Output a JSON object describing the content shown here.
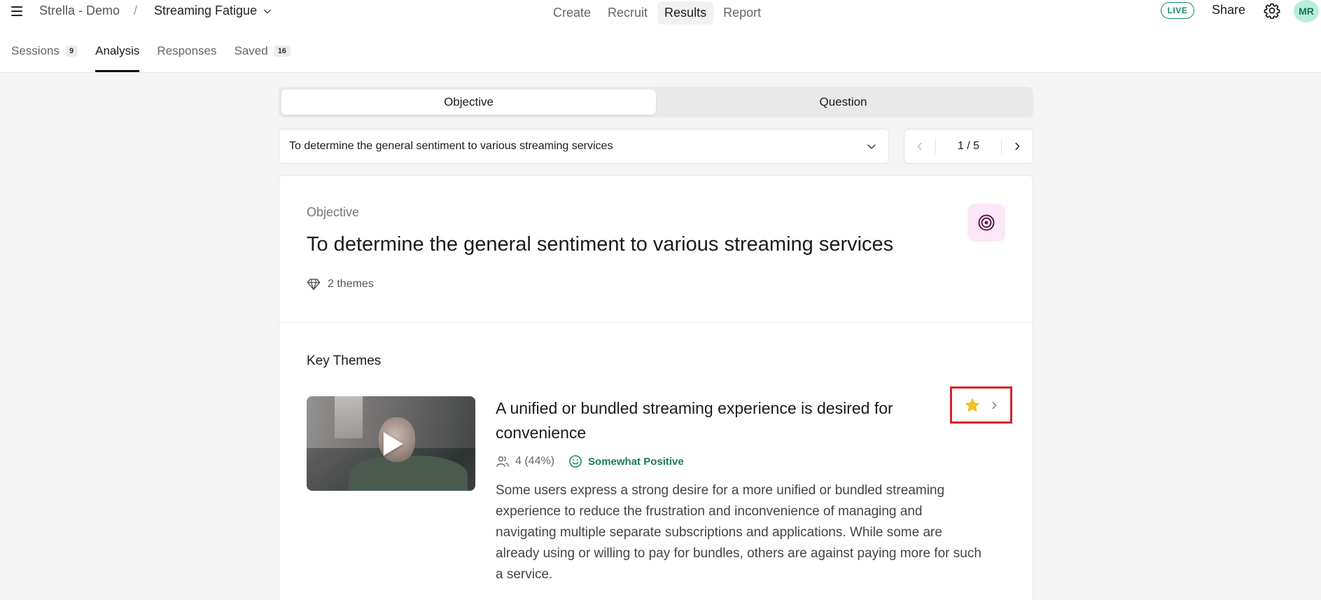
{
  "header": {
    "org": "Strella - Demo",
    "separator": "/",
    "project": "Streaming Fatigue",
    "nav": [
      "Create",
      "Recruit",
      "Results",
      "Report"
    ],
    "live": "LIVE",
    "share": "Share",
    "avatar_initials": "MR"
  },
  "tabs": [
    {
      "label": "Sessions",
      "count": "9"
    },
    {
      "label": "Analysis"
    },
    {
      "label": "Responses"
    },
    {
      "label": "Saved",
      "count": "16"
    }
  ],
  "segmented": {
    "objective": "Objective",
    "question": "Question"
  },
  "selector": {
    "value": "To determine the general sentiment to various streaming services"
  },
  "pager": {
    "label": "1 / 5"
  },
  "card": {
    "label": "Objective",
    "title": "To determine the general sentiment to various streaming services",
    "themes_count": "2 themes"
  },
  "key_themes": {
    "heading": "Key Themes",
    "theme": {
      "title": "A unified or bundled streaming experience is desired for convenience",
      "participants": "4 (44%)",
      "sentiment": "Somewhat Positive",
      "description": "Some users express a strong desire for a more unified or bundled streaming experience to reduce the frustration and inconvenience of managing and navigating multiple separate subscriptions and applications. While some are already using or willing to pay for bundles, others are against paying more for such a service."
    }
  },
  "colors": {
    "accent_green": "#1c8a6c",
    "star": "#f5c518",
    "highlight_red": "#d6232a",
    "target_pink": "#fbe7f7"
  }
}
